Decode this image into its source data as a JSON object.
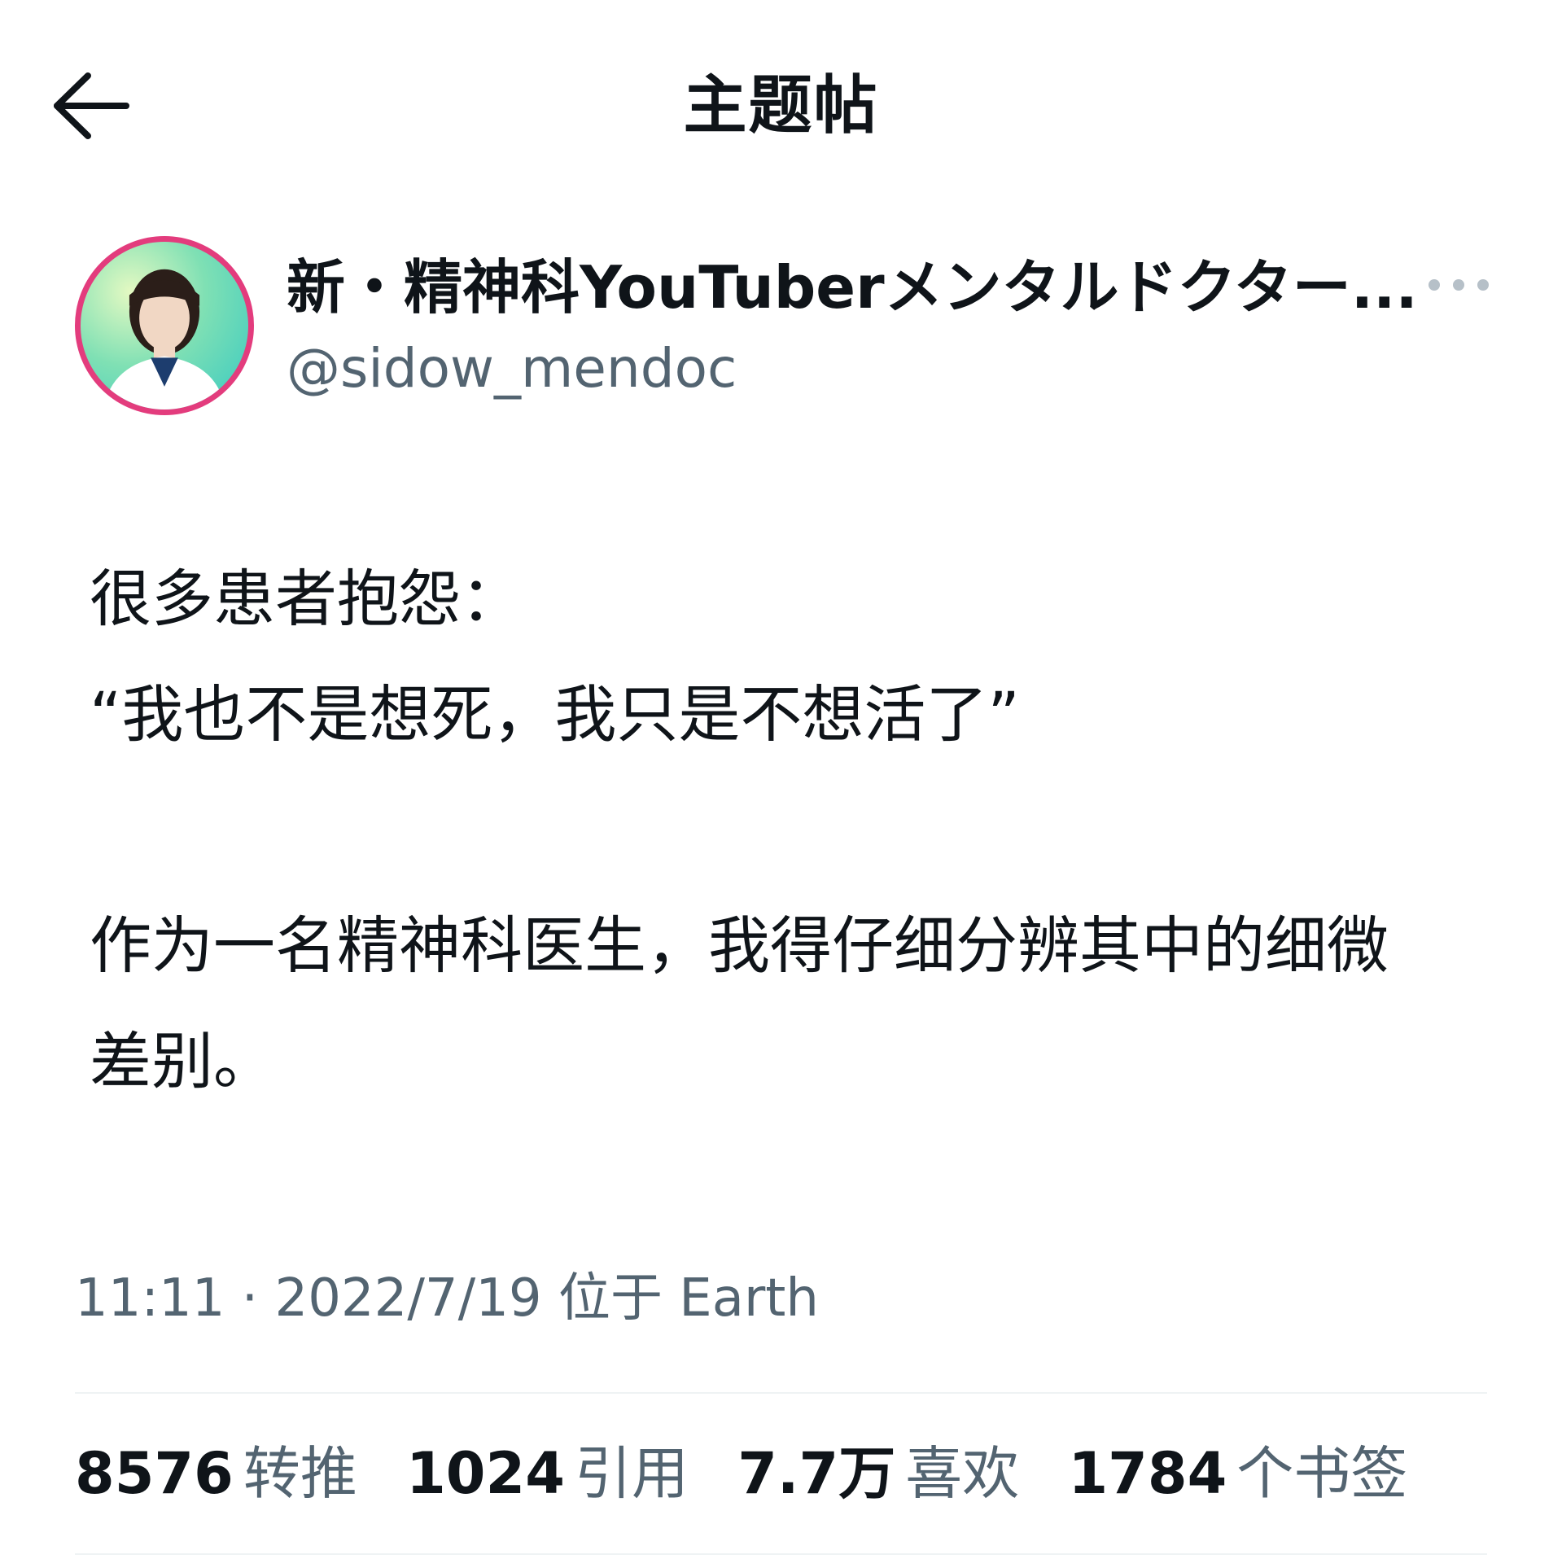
{
  "header": {
    "title": "主题帖",
    "back_icon": "arrow-left-icon"
  },
  "author": {
    "display_name": "新・精神科YouTuberメンタルドクター...",
    "handle": "@sidow_mendoc",
    "avatar_icon": "avatar-photo",
    "more_icon": "more-horizontal-icon",
    "avatar_ring_color": "#e33c7d"
  },
  "tweet": {
    "lines": [
      "很多患者抱怨：",
      "“我也不是想死，我只是不想活了”",
      "作为一名精神科医生，我得仔细分辨其中的细微",
      "差别。"
    ]
  },
  "meta": {
    "timestamp": "11:11 · 2022/7/19 位于 Earth"
  },
  "stats": [
    {
      "value": "8576",
      "label": "转推"
    },
    {
      "value": "1024",
      "label": "引用"
    },
    {
      "value": "7.7万",
      "label": "喜欢"
    },
    {
      "value": "1784",
      "label": "个书签"
    }
  ],
  "colors": {
    "primary_text": "#0f1419",
    "secondary_text": "#536471",
    "divider": "#eff3f4"
  }
}
